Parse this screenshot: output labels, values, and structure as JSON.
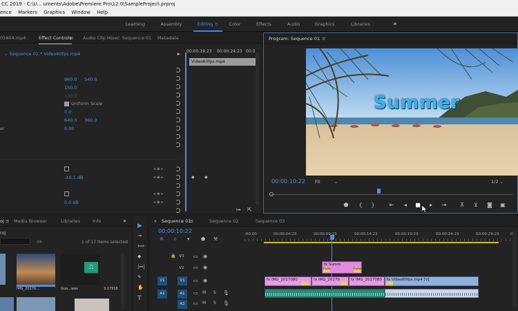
{
  "titlebar": {
    "text": "CC 2019 - C:\\U...                    uments\\Adobe\\Premiere Pro\\12.0\\SampleProject.prproj"
  },
  "menu": [
    "ence",
    "Markers",
    "Graphics",
    "Window",
    "Help"
  ],
  "workspaces": {
    "items": [
      "Learning",
      "Assembly",
      "Editing",
      "Color",
      "Effects",
      "Audio",
      "Graphics",
      "Libraries"
    ],
    "active": "Editing",
    "more": "»"
  },
  "source_panel": {
    "tabs": [
      "05604.mp4",
      "Effect Controls",
      "Audio Clip Mixer: Sequence 01",
      "Metadata"
    ],
    "sequence_label": "Sequence 01 * Video60fps.mp4",
    "mini_timecodes": [
      "00:00:19:23",
      "00:00:24:23",
      "00:0"
    ],
    "clip_name": "Video60fps.mp4",
    "values": {
      "pos_x": "960.0",
      "pos_y": "540.0",
      "scale": "150.0",
      "scale_w": "100.0",
      "uniform_scale": "Uniform Scale",
      "rotation": "0.0",
      "anchor_x": "640.0",
      "anchor_y": "360.0",
      "flicker": "0.00",
      "volume": "-10.1 dB",
      "balance": "0.0 dB"
    },
    "row_label_er": "er"
  },
  "program": {
    "tab": "Program: Sequence 01",
    "title_overlay": "Summer",
    "timecode": "00:00:10:22",
    "fit": "Fit",
    "fraction": "1/2"
  },
  "project": {
    "tabs": [
      "oj",
      "Media Browser",
      "Libraries",
      "Info"
    ],
    "count": "1 of 17 items selected",
    "thumb_labels": [
      "IMG_20170...",
      "Gua...wav",
      "3:17916"
    ]
  },
  "timeline": {
    "tabs": [
      "Sequence 01",
      "Sequence 02",
      "Sequence 03"
    ],
    "timecode": "00:00:10:22",
    "ruler": [
      ":00:00",
      "00:00:04:23",
      "00:00:09:23",
      "00:00:14:23",
      "00:00:19:23",
      "00:00:24:23",
      "00:00:29:23",
      "00:"
    ],
    "tracks": [
      "V3",
      "V2",
      "V1",
      "A1",
      "A2"
    ],
    "src_tracks": [
      "V1",
      "A1"
    ],
    "clips": {
      "title": "Summ",
      "fx": "fx",
      "v1a": "IMG_2017080",
      "v1b": "IMG_20170",
      "v1c": "IMG_2017080",
      "v1d": "Video60fps.mp4 [V]",
      "fade": "Fade",
      "fadeB": "Fade"
    }
  },
  "colors": {
    "accent": "#4d8fe8",
    "clip_video": "#e59be7",
    "clip_audio": "#2a8a79",
    "playhead": "#4d8fe8"
  }
}
